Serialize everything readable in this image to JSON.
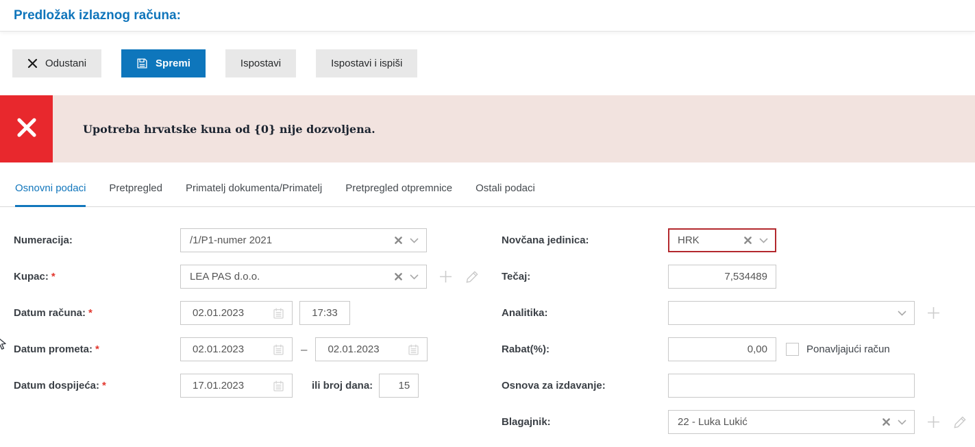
{
  "page_title": "Predložak izlaznog računa:",
  "toolbar": {
    "cancel_label": "Odustani",
    "save_label": "Spremi",
    "issue_label": "Ispostavi",
    "issue_print_label": "Ispostavi i ispiši"
  },
  "alert": {
    "message": "Upotreba hrvatske kuna od {0} nije dozvoljena."
  },
  "tabs": [
    {
      "label": "Osnovni podaci",
      "active": true
    },
    {
      "label": "Pretpregled",
      "active": false
    },
    {
      "label": "Primatelj dokumenta/Primatelj",
      "active": false
    },
    {
      "label": "Pretpregled otpremnice",
      "active": false
    },
    {
      "label": "Ostali podaci",
      "active": false
    }
  ],
  "form": {
    "required_marker": "*",
    "numeracija": {
      "label": "Numeracija:",
      "value": "/1/P1-numer 2021"
    },
    "kupac": {
      "label": "Kupac:",
      "value": "LEA PAS d.o.o."
    },
    "datum_racuna": {
      "label": "Datum računa:",
      "date": "02.01.2023",
      "time": "17:33"
    },
    "datum_prometa": {
      "label": "Datum prometa:",
      "date_from": "02.01.2023",
      "separator": "–",
      "date_to": "02.01.2023"
    },
    "datum_dospijeca": {
      "label": "Datum dospijeća:",
      "date": "17.01.2023",
      "days_label": "ili broj dana:",
      "days": "15"
    },
    "novcana_jedinica": {
      "label": "Novčana jedinica:",
      "value": "HRK"
    },
    "tecaj": {
      "label": "Tečaj:",
      "value": "7,534489"
    },
    "analitika": {
      "label": "Analitika:",
      "value": ""
    },
    "rabat": {
      "label": "Rabat(%):",
      "value": "0,00",
      "checkbox_label": "Ponavljajući račun",
      "checkbox_checked": false
    },
    "osnova": {
      "label": "Osnova za izdavanje:",
      "value": ""
    },
    "blagajnik": {
      "label": "Blagajnik:",
      "value": "22 - Luka Lukić"
    }
  },
  "icons": {
    "cancel": "✕",
    "save": "💾",
    "alert_close": "✕",
    "clear": "✕",
    "chevron_down": "⌄",
    "calendar": "🗓",
    "plus": "+",
    "pencil": "✎",
    "checkbox_unchecked": "☐",
    "mouse_cursor": "↖"
  },
  "colors": {
    "accent_blue": "#0e76bc",
    "title_blue": "#0f75bb",
    "error_red": "#e8282d",
    "alert_bg": "#f2e3df",
    "invalid_field_border": "#b3282d",
    "button_gray": "#e8e8e8"
  }
}
